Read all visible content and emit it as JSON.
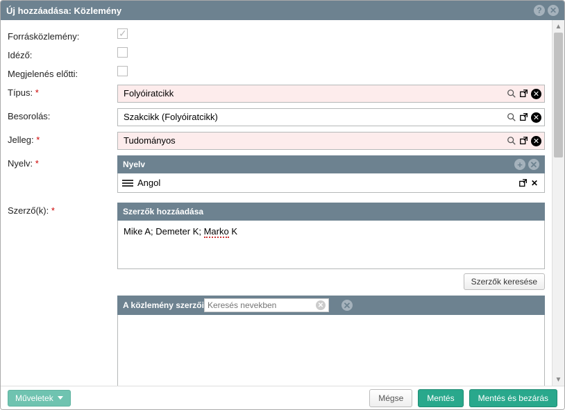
{
  "dialog": {
    "title": "Új hozzáadása: Közlemény"
  },
  "labels": {
    "source": "Forrásközlemény:",
    "idezo": "Idéző:",
    "prepub": "Megjelenés előtti:",
    "type": "Típus:",
    "category": "Besorolás:",
    "jelleg": "Jelleg:",
    "nyelv": "Nyelv:",
    "authors": "Szerző(k):"
  },
  "fields": {
    "type": "Folyóiratcikk",
    "category": "Szakcikk (Folyóiratcikk)",
    "jelleg": "Tudományos",
    "nyelv_header": "Nyelv",
    "nyelv_value": "Angol",
    "authors_header": "Szerzők hozzáadása",
    "authors_value_1": "Mike A; Demeter K; ",
    "authors_value_2": "Marko",
    "authors_value_3": " K",
    "authors_list_header": "A közlemény szerzői",
    "search_placeholder": "Keresés nevekben"
  },
  "buttons": {
    "search_authors": "Szerzők keresése",
    "ops": "Műveletek",
    "cancel": "Mégse",
    "save": "Mentés",
    "save_close": "Mentés és bezárás"
  }
}
